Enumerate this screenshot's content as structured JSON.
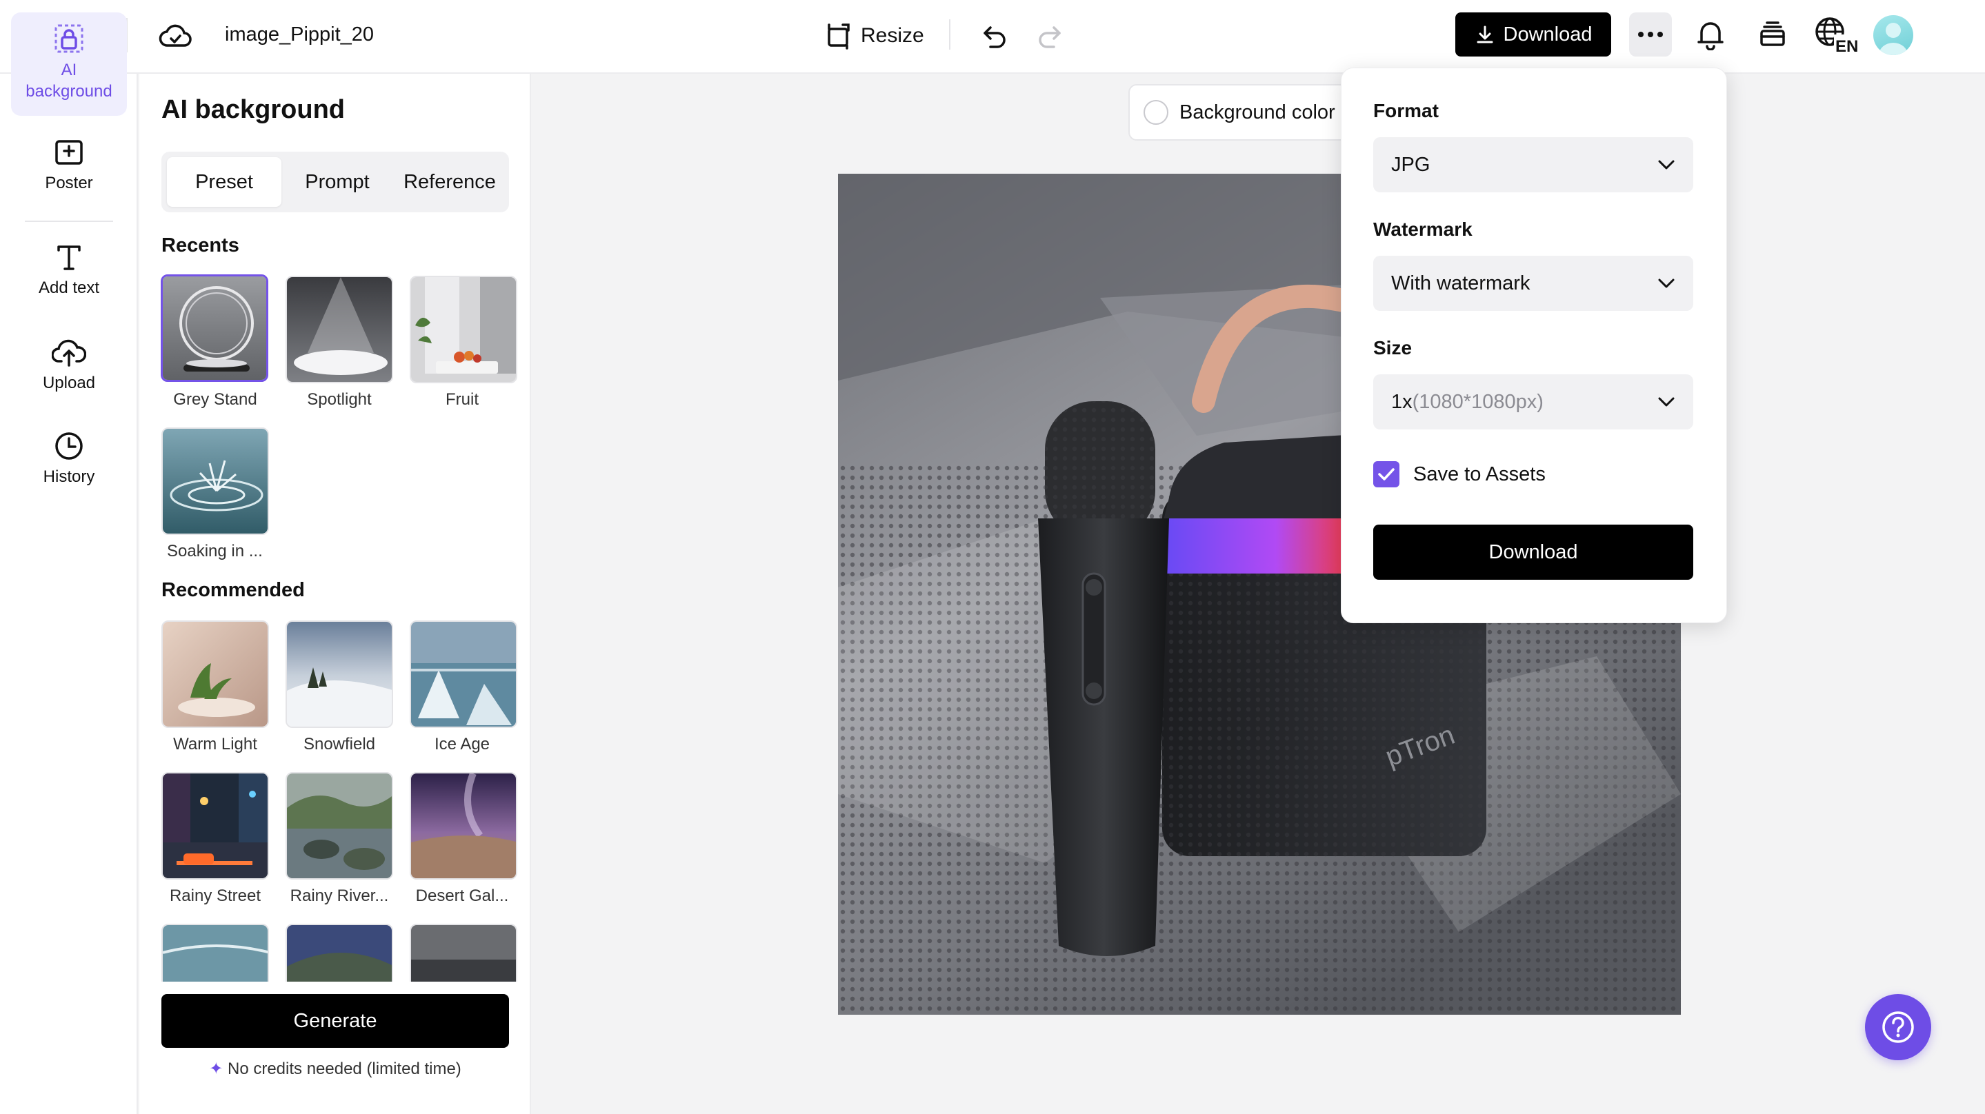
{
  "header": {
    "doc_title": "image_Pippit_20",
    "resize_label": "Resize",
    "download_label": "Download",
    "language_code": "EN"
  },
  "rail": {
    "items": [
      {
        "label_line1": "AI",
        "label_line2": "background",
        "icon": "ai-background-icon",
        "active": true
      },
      {
        "label": "Poster",
        "icon": "poster-icon"
      },
      {
        "label": "Add text",
        "icon": "text-icon"
      },
      {
        "label": "Upload",
        "icon": "upload-icon"
      },
      {
        "label": "History",
        "icon": "history-icon"
      }
    ]
  },
  "panel": {
    "title": "AI background",
    "tabs": [
      "Preset",
      "Prompt",
      "Reference"
    ],
    "active_tab": "Preset",
    "recents_title": "Recents",
    "recents": [
      "Grey Stand",
      "Spotlight",
      "Fruit",
      "Soaking in ..."
    ],
    "recommended_title": "Recommended",
    "recommended": [
      "Warm Light",
      "Snowfield",
      "Ice Age",
      "Rainy Street",
      "Rainy River...",
      "Desert Gal..."
    ],
    "generate_label": "Generate",
    "credits_note": "No credits needed (limited time)"
  },
  "canvas": {
    "background_color_label": "Background color"
  },
  "download_popover": {
    "format_label": "Format",
    "format_value": "JPG",
    "watermark_label": "Watermark",
    "watermark_value": "With watermark",
    "size_label": "Size",
    "size_value_main": "1x",
    "size_value_detail": "(1080*1080px)",
    "save_to_assets_label": "Save to Assets",
    "save_to_assets_checked": true,
    "download_label": "Download"
  },
  "colors": {
    "accent": "#6e4de6",
    "primary_button": "#000000",
    "rail_active_bg": "#efeefd"
  }
}
